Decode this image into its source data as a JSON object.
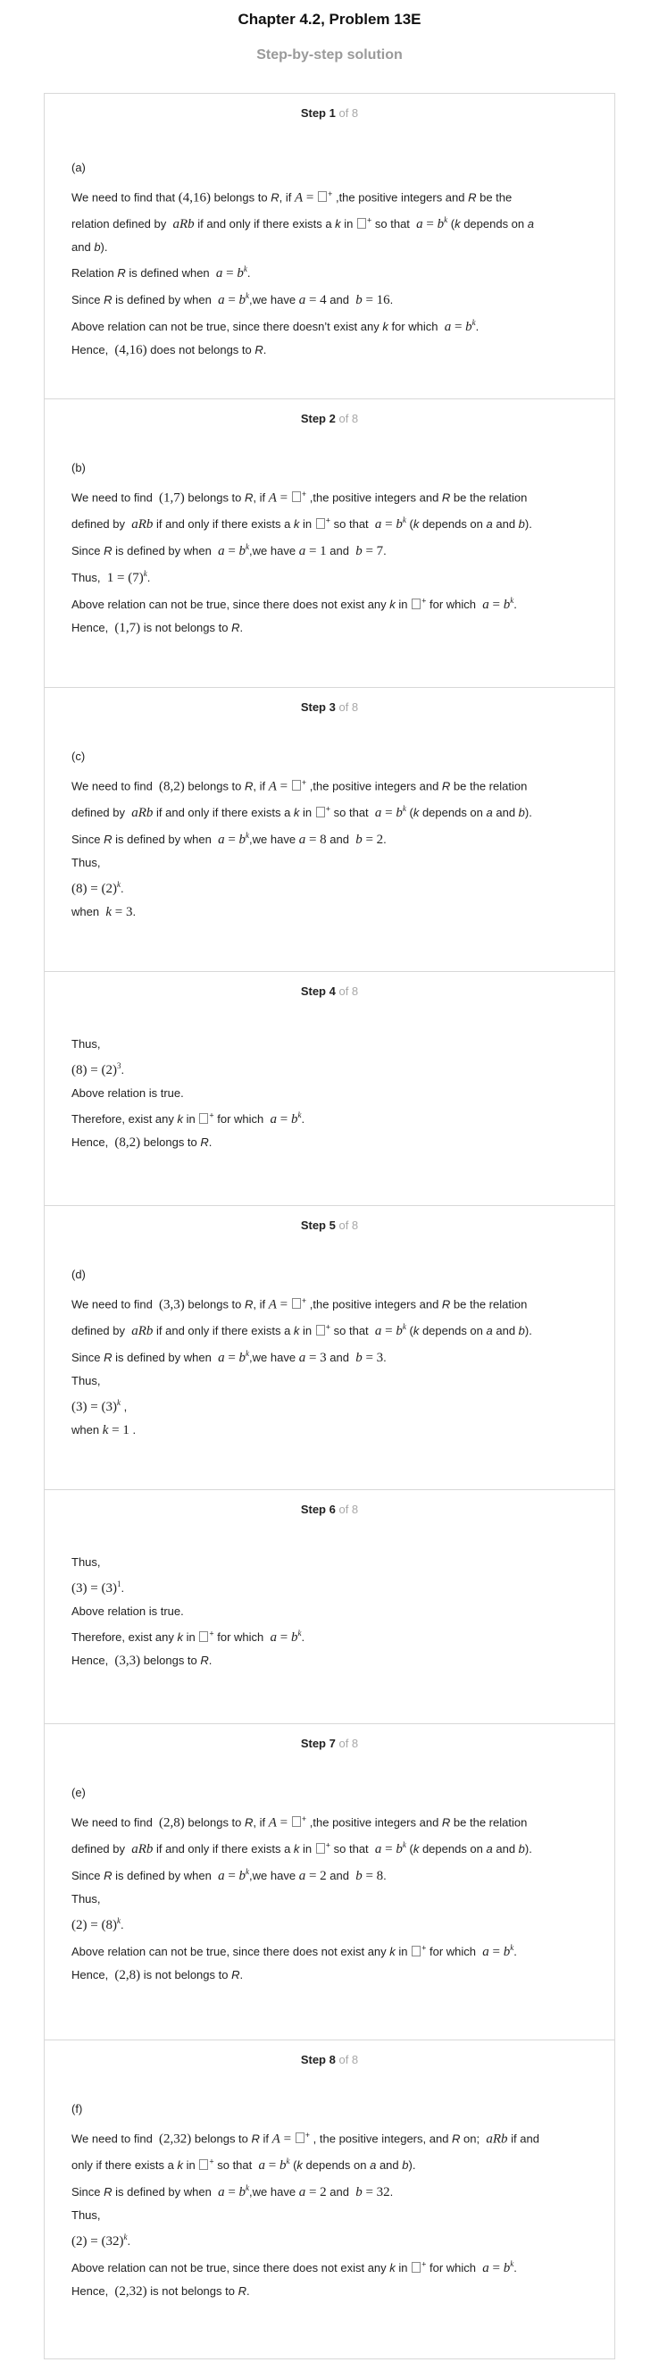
{
  "header": {
    "title": "Chapter 4.2, Problem 13E",
    "subtitle": "Step-by-step solution"
  },
  "steps": [
    {
      "label": "Step 1",
      "of": "of 8",
      "part": "(a)"
    },
    {
      "label": "Step 2",
      "of": "of 8",
      "part": "(b)"
    },
    {
      "label": "Step 3",
      "of": "of 8",
      "part": "(c)"
    },
    {
      "label": "Step 4",
      "of": "of 8"
    },
    {
      "label": "Step 5",
      "of": "of 8",
      "part": "(d)"
    },
    {
      "label": "Step 6",
      "of": "of 8"
    },
    {
      "label": "Step 7",
      "of": "of 8",
      "part": "(e)"
    },
    {
      "label": "Step 8",
      "of": "of 8",
      "part": "(f)"
    }
  ]
}
